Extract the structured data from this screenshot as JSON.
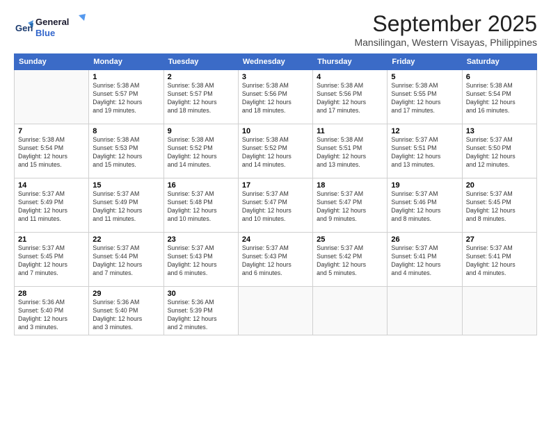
{
  "header": {
    "logo_line1": "General",
    "logo_line2": "Blue",
    "month": "September 2025",
    "location": "Mansilingan, Western Visayas, Philippines"
  },
  "weekdays": [
    "Sunday",
    "Monday",
    "Tuesday",
    "Wednesday",
    "Thursday",
    "Friday",
    "Saturday"
  ],
  "weeks": [
    [
      {
        "day": "",
        "info": ""
      },
      {
        "day": "1",
        "info": "Sunrise: 5:38 AM\nSunset: 5:57 PM\nDaylight: 12 hours\nand 19 minutes."
      },
      {
        "day": "2",
        "info": "Sunrise: 5:38 AM\nSunset: 5:57 PM\nDaylight: 12 hours\nand 18 minutes."
      },
      {
        "day": "3",
        "info": "Sunrise: 5:38 AM\nSunset: 5:56 PM\nDaylight: 12 hours\nand 18 minutes."
      },
      {
        "day": "4",
        "info": "Sunrise: 5:38 AM\nSunset: 5:56 PM\nDaylight: 12 hours\nand 17 minutes."
      },
      {
        "day": "5",
        "info": "Sunrise: 5:38 AM\nSunset: 5:55 PM\nDaylight: 12 hours\nand 17 minutes."
      },
      {
        "day": "6",
        "info": "Sunrise: 5:38 AM\nSunset: 5:54 PM\nDaylight: 12 hours\nand 16 minutes."
      }
    ],
    [
      {
        "day": "7",
        "info": "Sunrise: 5:38 AM\nSunset: 5:54 PM\nDaylight: 12 hours\nand 15 minutes."
      },
      {
        "day": "8",
        "info": "Sunrise: 5:38 AM\nSunset: 5:53 PM\nDaylight: 12 hours\nand 15 minutes."
      },
      {
        "day": "9",
        "info": "Sunrise: 5:38 AM\nSunset: 5:52 PM\nDaylight: 12 hours\nand 14 minutes."
      },
      {
        "day": "10",
        "info": "Sunrise: 5:38 AM\nSunset: 5:52 PM\nDaylight: 12 hours\nand 14 minutes."
      },
      {
        "day": "11",
        "info": "Sunrise: 5:38 AM\nSunset: 5:51 PM\nDaylight: 12 hours\nand 13 minutes."
      },
      {
        "day": "12",
        "info": "Sunrise: 5:37 AM\nSunset: 5:51 PM\nDaylight: 12 hours\nand 13 minutes."
      },
      {
        "day": "13",
        "info": "Sunrise: 5:37 AM\nSunset: 5:50 PM\nDaylight: 12 hours\nand 12 minutes."
      }
    ],
    [
      {
        "day": "14",
        "info": "Sunrise: 5:37 AM\nSunset: 5:49 PM\nDaylight: 12 hours\nand 11 minutes."
      },
      {
        "day": "15",
        "info": "Sunrise: 5:37 AM\nSunset: 5:49 PM\nDaylight: 12 hours\nand 11 minutes."
      },
      {
        "day": "16",
        "info": "Sunrise: 5:37 AM\nSunset: 5:48 PM\nDaylight: 12 hours\nand 10 minutes."
      },
      {
        "day": "17",
        "info": "Sunrise: 5:37 AM\nSunset: 5:47 PM\nDaylight: 12 hours\nand 10 minutes."
      },
      {
        "day": "18",
        "info": "Sunrise: 5:37 AM\nSunset: 5:47 PM\nDaylight: 12 hours\nand 9 minutes."
      },
      {
        "day": "19",
        "info": "Sunrise: 5:37 AM\nSunset: 5:46 PM\nDaylight: 12 hours\nand 8 minutes."
      },
      {
        "day": "20",
        "info": "Sunrise: 5:37 AM\nSunset: 5:45 PM\nDaylight: 12 hours\nand 8 minutes."
      }
    ],
    [
      {
        "day": "21",
        "info": "Sunrise: 5:37 AM\nSunset: 5:45 PM\nDaylight: 12 hours\nand 7 minutes."
      },
      {
        "day": "22",
        "info": "Sunrise: 5:37 AM\nSunset: 5:44 PM\nDaylight: 12 hours\nand 7 minutes."
      },
      {
        "day": "23",
        "info": "Sunrise: 5:37 AM\nSunset: 5:43 PM\nDaylight: 12 hours\nand 6 minutes."
      },
      {
        "day": "24",
        "info": "Sunrise: 5:37 AM\nSunset: 5:43 PM\nDaylight: 12 hours\nand 6 minutes."
      },
      {
        "day": "25",
        "info": "Sunrise: 5:37 AM\nSunset: 5:42 PM\nDaylight: 12 hours\nand 5 minutes."
      },
      {
        "day": "26",
        "info": "Sunrise: 5:37 AM\nSunset: 5:41 PM\nDaylight: 12 hours\nand 4 minutes."
      },
      {
        "day": "27",
        "info": "Sunrise: 5:37 AM\nSunset: 5:41 PM\nDaylight: 12 hours\nand 4 minutes."
      }
    ],
    [
      {
        "day": "28",
        "info": "Sunrise: 5:36 AM\nSunset: 5:40 PM\nDaylight: 12 hours\nand 3 minutes."
      },
      {
        "day": "29",
        "info": "Sunrise: 5:36 AM\nSunset: 5:40 PM\nDaylight: 12 hours\nand 3 minutes."
      },
      {
        "day": "30",
        "info": "Sunrise: 5:36 AM\nSunset: 5:39 PM\nDaylight: 12 hours\nand 2 minutes."
      },
      {
        "day": "",
        "info": ""
      },
      {
        "day": "",
        "info": ""
      },
      {
        "day": "",
        "info": ""
      },
      {
        "day": "",
        "info": ""
      }
    ]
  ]
}
